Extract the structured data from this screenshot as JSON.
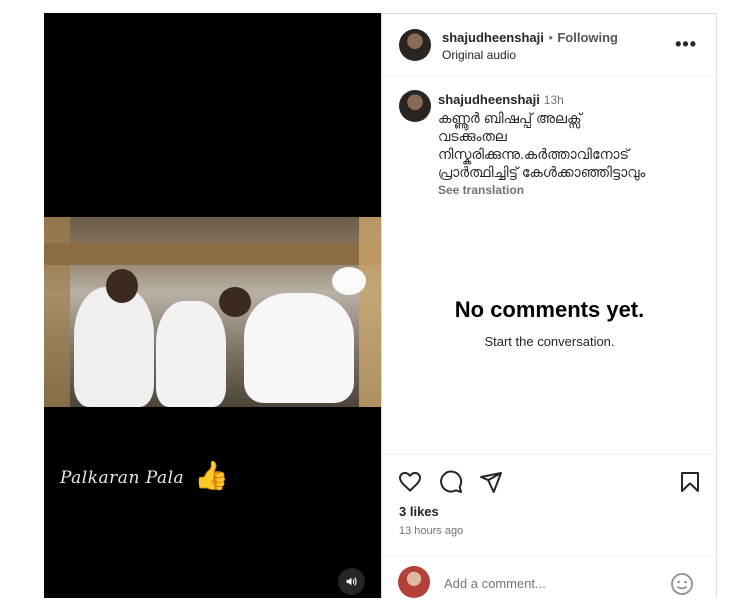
{
  "post": {
    "username": "shajudheenshaji",
    "separator": "•",
    "follow_status": "Following",
    "audio": "Original audio",
    "more_icon": "more-horizontal-icon",
    "caption_user": "shajudheenshaji",
    "caption_time": "13h",
    "caption_lines": [
      "കണ്ണൂർ ബിഷപ്പ് അലക്സ്",
      "വടക്കുംതല",
      "നിസ്കരിക്കുന്നു.കർത്താവിനോട്",
      "പ്രാർത്ഥിച്ചിട്ട് കേൾക്കാഞ്ഞിട്ടാവും"
    ],
    "see_translation": "See translation"
  },
  "comments": {
    "empty_title": "No comments yet.",
    "empty_subtitle": "Start the conversation."
  },
  "actions": {
    "like_icon": "heart-icon",
    "comment_icon": "comment-icon",
    "share_icon": "send-icon",
    "save_icon": "bookmark-icon",
    "likes": "3 likes",
    "time_ago": "13 hours ago"
  },
  "add_comment": {
    "placeholder": "Add a comment...",
    "emoji_icon": "emoji-icon"
  },
  "media": {
    "watermark": "Palkaran Pala",
    "thumb_emoji": "👍",
    "mute_icon": "speaker-icon"
  }
}
